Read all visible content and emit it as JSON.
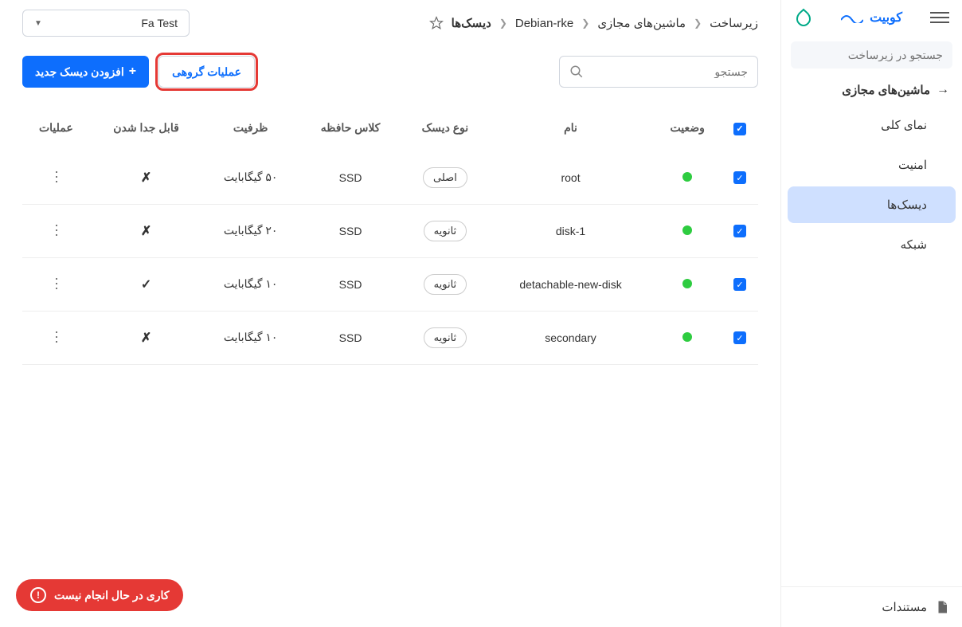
{
  "header": {
    "brand": "کوبیت",
    "fa_select": "Fa Test"
  },
  "sidebar": {
    "search_placeholder": "جستجو در زیرساخت",
    "section_title": "ماشین‌های مجازی",
    "items": [
      {
        "label": "نمای کلی",
        "active": false
      },
      {
        "label": "امنیت",
        "active": false
      },
      {
        "label": "دیسک‌ها",
        "active": true
      },
      {
        "label": "شبکه",
        "active": false
      }
    ],
    "footer_docs": "مستندات"
  },
  "breadcrumbs": [
    "زیرساخت",
    "ماشین‌های مجازی",
    "Debian-rke",
    "دیسک‌ها"
  ],
  "toolbar": {
    "search_placeholder": "جستجو",
    "group_ops": "عملیات گروهی",
    "add_disk": "افزودن دیسک جدید"
  },
  "table": {
    "headers": {
      "status": "وضعیت",
      "name": "نام",
      "disk_type": "نوع دیسک",
      "storage_class": "کلاس حافظه",
      "capacity": "ظرفیت",
      "detachable": "قابل جدا شدن",
      "actions": "عملیات"
    },
    "rows": [
      {
        "name": "root",
        "type": "اصلی",
        "class": "SSD",
        "capacity": "۵۰ گیگابایت",
        "detachable": "✗"
      },
      {
        "name": "disk-1",
        "type": "ثانویه",
        "class": "SSD",
        "capacity": "۲۰ گیگابایت",
        "detachable": "✗"
      },
      {
        "name": "detachable-new-disk",
        "type": "ثانویه",
        "class": "SSD",
        "capacity": "۱۰ گیگابایت",
        "detachable": "✓"
      },
      {
        "name": "secondary",
        "type": "ثانویه",
        "class": "SSD",
        "capacity": "۱۰ گیگابایت",
        "detachable": "✗"
      }
    ]
  },
  "toast": {
    "message": "کاری در حال انجام نیست"
  }
}
